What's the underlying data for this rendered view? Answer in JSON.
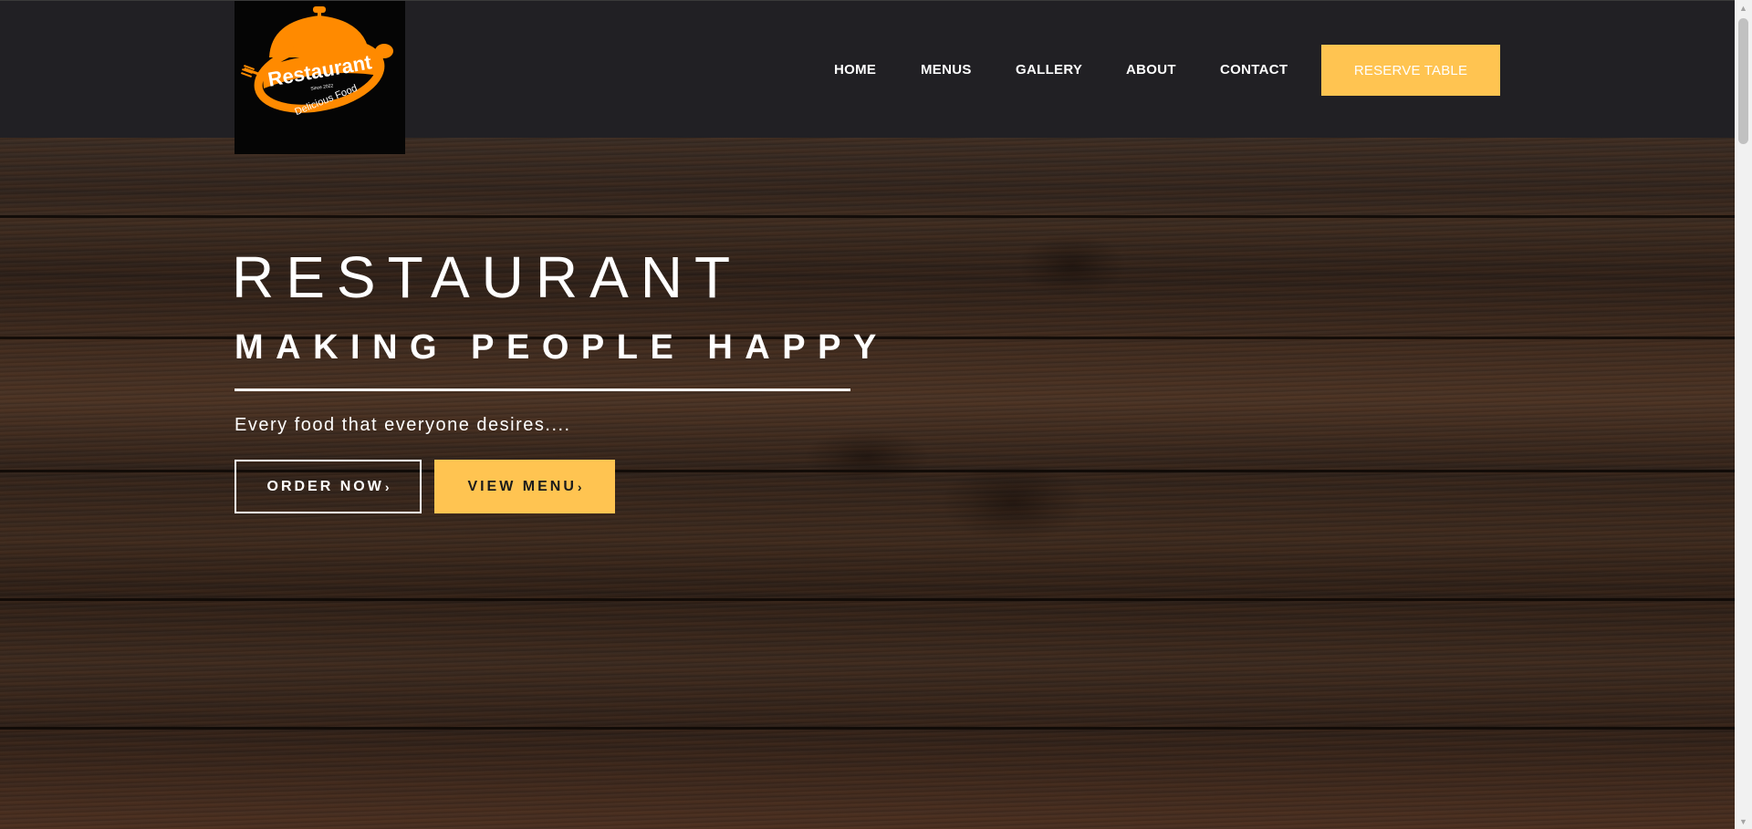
{
  "brand": {
    "logo_text": "Restaurant",
    "logo_tagline": "Delicious Food",
    "logo_since": "Since 2022",
    "logo_color": "#ff8a00"
  },
  "nav": {
    "items": [
      {
        "label": "HOME"
      },
      {
        "label": "MENUS"
      },
      {
        "label": "GALLERY"
      },
      {
        "label": "ABOUT"
      },
      {
        "label": "CONTACT"
      }
    ],
    "cta_label": "RESERVE TABLE"
  },
  "hero": {
    "title": "RESTAURANT",
    "subtitle": "MAKING PEOPLE HAPPY",
    "tagline": "Every food that everyone desires....",
    "order_button": "ORDER NOW",
    "view_button": "VIEW MENU",
    "chevron": "›"
  },
  "colors": {
    "accent": "#ffc451",
    "header_bg": "#212024",
    "text": "#ffffff"
  },
  "icons": {
    "scroll_up": "triangle-up-icon",
    "scroll_down": "triangle-down-icon",
    "logo_emblem": "cloche-fork-spoon-icon"
  }
}
